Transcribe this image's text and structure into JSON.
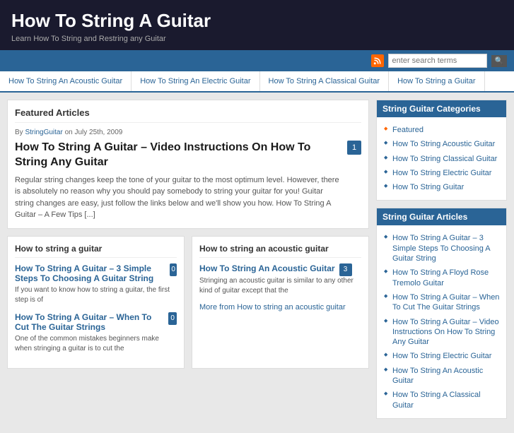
{
  "header": {
    "title": "How To String A Guitar",
    "subtitle": "Learn How To String and Restring any Guitar"
  },
  "topbar": {
    "search_placeholder": "enter search terms"
  },
  "nav": {
    "tabs": [
      {
        "label": "How To String An Acoustic Guitar",
        "active": false
      },
      {
        "label": "How To String An Electric Guitar",
        "active": false
      },
      {
        "label": "How To String A Classical Guitar",
        "active": false
      },
      {
        "label": "How To String a Guitar",
        "active": false
      }
    ]
  },
  "featured": {
    "heading": "Featured Articles",
    "author": "StringGuitar",
    "date": "July 25th, 2009",
    "title": "How To String A Guitar – Video Instructions On How To String Any Guitar",
    "badge": "1",
    "excerpt": "Regular string changes keep the tone of your guitar to the most optimum level.  However, there is absolutely no reason why you should pay somebody to string your guitar for you!  Guitar string changes are easy, just follow the links below and we'll show you how. How To String A Guitar – A Few Tips [...]"
  },
  "col_left": {
    "heading": "How to string a guitar",
    "articles": [
      {
        "title": "How To String A Guitar – 3 Simple Steps To Choosing A Guitar String",
        "badge": "0",
        "excerpt": "If you want to know how to string a guitar, the first step is of"
      },
      {
        "title": "How To String A Guitar – When To Cut The Guitar Strings",
        "badge": "0",
        "excerpt": "One of the common mistakes beginners make when stringing a guitar is to cut the"
      }
    ]
  },
  "col_right": {
    "heading": "How to string an acoustic guitar",
    "articles": [
      {
        "title": "How To String An Acoustic Guitar",
        "badge": "3",
        "excerpt": "Stringing an acoustic guitar is similar to any other kind of guitar except that the"
      }
    ],
    "more_link": "More from How to string an acoustic guitar"
  },
  "sidebar": {
    "categories": {
      "heading": "String Guitar Categories",
      "items": [
        {
          "label": "Featured",
          "featured": true
        },
        {
          "label": "How To String Acoustic Guitar",
          "featured": false
        },
        {
          "label": "How To String Classical Guitar",
          "featured": false
        },
        {
          "label": "How To String Electric Guitar",
          "featured": false
        },
        {
          "label": "How To String Guitar",
          "featured": false
        }
      ]
    },
    "articles": {
      "heading": "String Guitar Articles",
      "items": [
        {
          "label": "How To String A Guitar – 3 Simple Steps To Choosing A Guitar String"
        },
        {
          "label": "How To String A Floyd Rose Tremolo Guitar"
        },
        {
          "label": "How To String A Guitar – When To Cut The Guitar Strings"
        },
        {
          "label": "How To String A Guitar – Video Instructions On How To String Any Guitar"
        },
        {
          "label": "How To String Electric Guitar"
        },
        {
          "label": "How To String An Acoustic Guitar"
        },
        {
          "label": "How To String A Classical Guitar"
        }
      ]
    }
  }
}
